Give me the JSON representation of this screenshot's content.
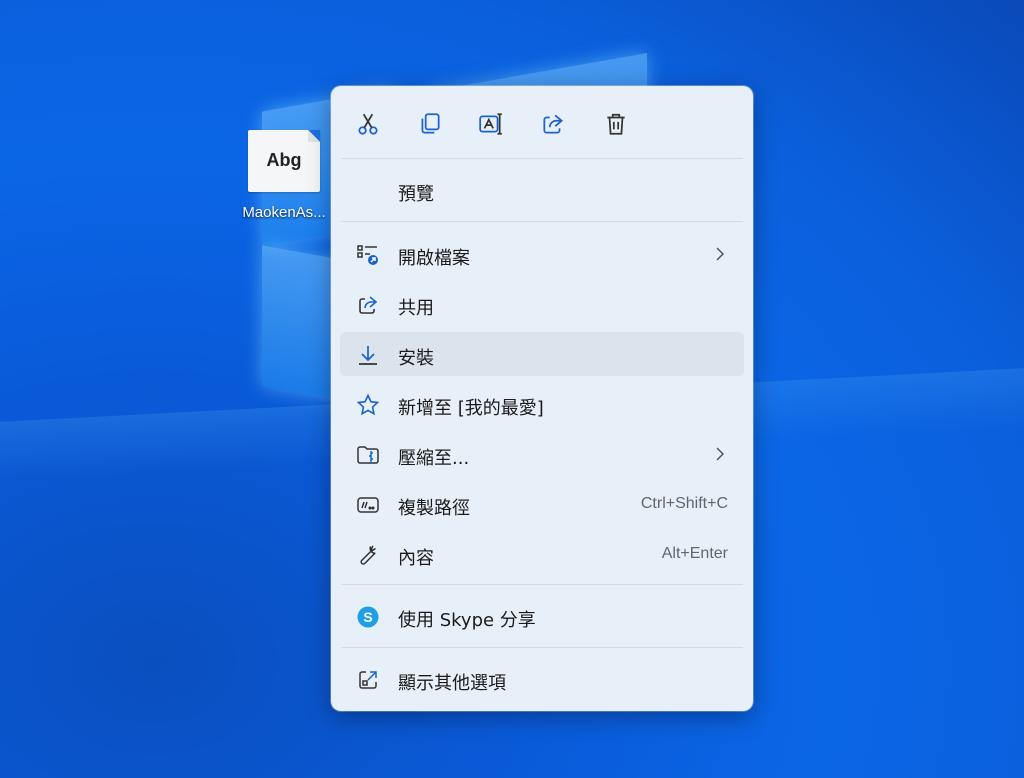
{
  "desktop": {
    "file_icon_text": "Abg",
    "file_label": "MaokenAs..."
  },
  "context_menu": {
    "toolbar": [
      {
        "name": "cut-icon"
      },
      {
        "name": "copy-icon"
      },
      {
        "name": "rename-icon"
      },
      {
        "name": "share-icon"
      },
      {
        "name": "delete-icon"
      }
    ],
    "preview": {
      "label": "預覽"
    },
    "items": [
      {
        "label": "開啟檔案",
        "icon": "open-with-icon",
        "submenu": true
      },
      {
        "label": "共用",
        "icon": "share-icon"
      },
      {
        "label": "安裝",
        "icon": "download-icon",
        "highlighted": true
      },
      {
        "label": "新增至 [我的最愛]",
        "icon": "star-icon"
      },
      {
        "label": "壓縮至...",
        "icon": "zip-folder-icon",
        "submenu": true
      },
      {
        "label": "複製路徑",
        "icon": "copy-path-icon",
        "shortcut": "Ctrl+Shift+C"
      },
      {
        "label": "內容",
        "icon": "wrench-icon",
        "shortcut": "Alt+Enter"
      }
    ],
    "skype": {
      "label": "使用 Skype 分享",
      "icon": "skype-icon"
    },
    "more": {
      "label": "顯示其他選項",
      "icon": "external-icon"
    }
  },
  "colors": {
    "accent": "#1b62c9",
    "menu_bg": "#e7eff9",
    "hover_bg": "#dbe3ed"
  }
}
